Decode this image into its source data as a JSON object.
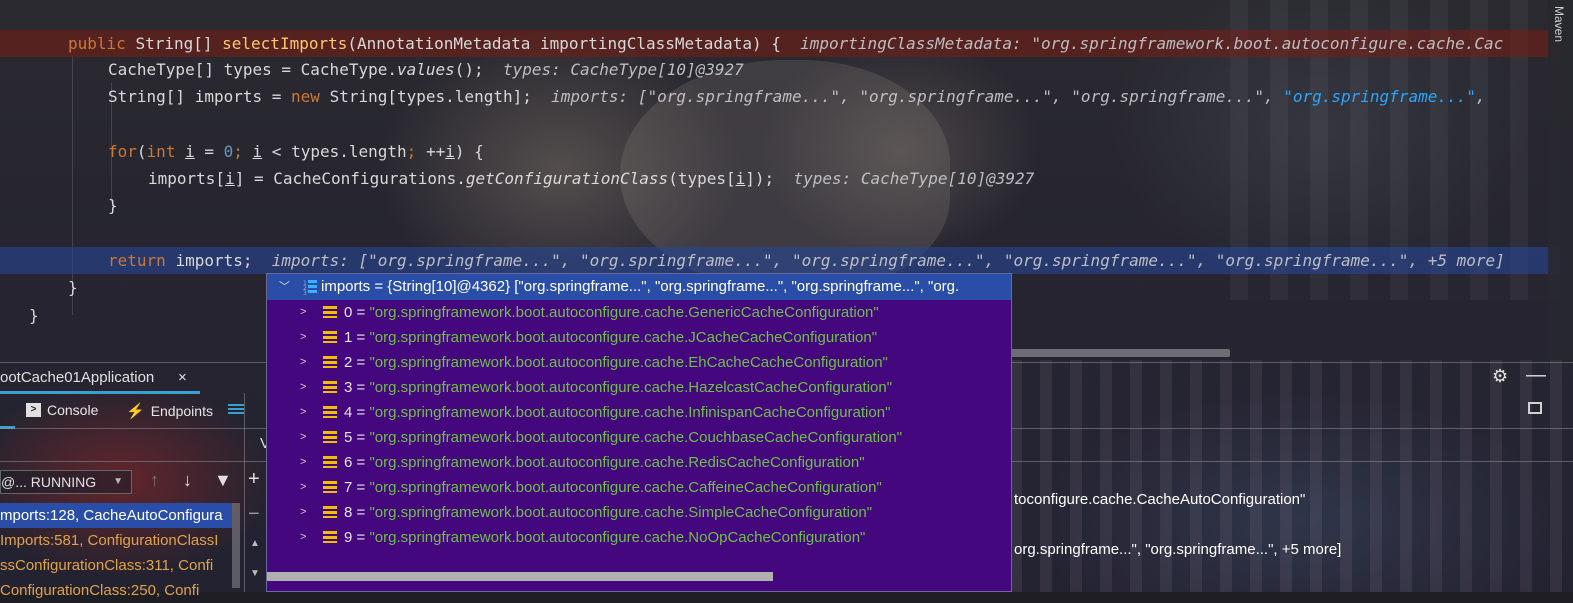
{
  "editor": {
    "lines": [
      {
        "segments": [
          {
            "t": "public ",
            "c": "kw"
          },
          {
            "t": "String[] ",
            "c": "txt"
          },
          {
            "t": "selectImports",
            "c": "fn"
          },
          {
            "t": "(AnnotationMetadata importingClassMetadata) {  ",
            "c": "txt"
          },
          {
            "t": "importingClassMetadata: \"org.springframework.boot.autoconfigure.cache.Cac",
            "c": "hint"
          }
        ]
      },
      {
        "segments": [
          {
            "t": "CacheType[] types = CacheType.",
            "c": "txt"
          },
          {
            "t": "values",
            "c": "it"
          },
          {
            "t": "();  ",
            "c": "txt"
          },
          {
            "t": "types: CacheType[10]@3927",
            "c": "hint"
          }
        ]
      },
      {
        "segments": [
          {
            "t": "String[] imports = ",
            "c": "txt"
          },
          {
            "t": "new ",
            "c": "kw"
          },
          {
            "t": "String[types.",
            "c": "txt"
          },
          {
            "t": "length",
            "c": "txt"
          },
          {
            "t": "];  ",
            "c": "txt"
          },
          {
            "t": "imports: [\"org.springframe...\", \"org.springframe...\", \"org.springframe...\", ",
            "c": "hint"
          },
          {
            "t": "\"org.springframe...\"",
            "c": "hint-blue"
          },
          {
            "t": ",",
            "c": "hint"
          }
        ]
      },
      {
        "segments": []
      },
      {
        "segments": [
          {
            "t": "for",
            "c": "kw"
          },
          {
            "t": "(",
            "c": "txt"
          },
          {
            "t": "int ",
            "c": "kw"
          },
          {
            "t": "i",
            "c": "ul"
          },
          {
            "t": " = ",
            "c": "txt"
          },
          {
            "t": "0",
            "c": "num"
          },
          {
            "t": "; ",
            "c": "kw"
          },
          {
            "t": "i",
            "c": "ul"
          },
          {
            "t": " < types.",
            "c": "txt"
          },
          {
            "t": "length",
            "c": "txt"
          },
          {
            "t": "; ",
            "c": "kw"
          },
          {
            "t": "++",
            "c": "txt"
          },
          {
            "t": "i",
            "c": "ul"
          },
          {
            "t": ") {",
            "c": "txt"
          }
        ]
      },
      {
        "segments": [
          {
            "t": "imports[",
            "c": "txt"
          },
          {
            "t": "i",
            "c": "ul"
          },
          {
            "t": "] = CacheConfigurations.",
            "c": "txt"
          },
          {
            "t": "getConfigurationClass",
            "c": "it"
          },
          {
            "t": "(types[",
            "c": "txt"
          },
          {
            "t": "i",
            "c": "ul"
          },
          {
            "t": "]);  ",
            "c": "txt"
          },
          {
            "t": "types: CacheType[10]@3927",
            "c": "hint"
          }
        ]
      },
      {
        "segments": [
          {
            "t": "}",
            "c": "txt"
          }
        ]
      },
      {
        "segments": []
      },
      {
        "segments": [
          {
            "t": "return ",
            "c": "kw"
          },
          {
            "t": "imports;  ",
            "c": "txt"
          },
          {
            "t": "imports: [\"org.springframe...\", \"org.springframe...\", \"org.springframe...\", \"org.springframe...\", \"org.springframe...\", +5 more]",
            "c": "hint"
          }
        ]
      },
      {
        "segments": [
          {
            "t": "}",
            "c": "txt"
          }
        ]
      },
      {
        "segments": [
          {
            "t": "}",
            "c": "txt"
          }
        ]
      }
    ]
  },
  "tool_strip": {
    "maven_label": "Maven"
  },
  "run": {
    "tab_label": "ootCache01Application",
    "tab_close": "×",
    "subtabs": {
      "console": "Console",
      "endpoints": "Endpoints"
    },
    "var_tab_partial": "V",
    "thread_selector": "@... RUNNING",
    "frames": [
      {
        "text": "mports:128, CacheAutoConfigura",
        "kind": "sel"
      },
      {
        "text": "Imports:581, ConfigurationClassI",
        "kind": "lib"
      },
      {
        "text": "ssConfigurationClass:311, Confi",
        "kind": "lib"
      },
      {
        "text": "ConfigurationClass:250, Confi",
        "kind": "lib"
      }
    ],
    "bg_var_1": "toconfigure.cache.CacheAutoConfiguration\"",
    "bg_var_2": "org.springframe...\", \"org.springframe...\", +5 more]"
  },
  "popup": {
    "header": "imports = {String[10]@4362} [\"org.springframe...\", \"org.springframe...\", \"org.springframe...\", \"org.",
    "items": [
      {
        "idx": "0 = ",
        "val": "\"org.springframework.boot.autoconfigure.cache.GenericCacheConfiguration\""
      },
      {
        "idx": "1 = ",
        "val": "\"org.springframework.boot.autoconfigure.cache.JCacheCacheConfiguration\""
      },
      {
        "idx": "2 = ",
        "val": "\"org.springframework.boot.autoconfigure.cache.EhCacheCacheConfiguration\""
      },
      {
        "idx": "3 = ",
        "val": "\"org.springframework.boot.autoconfigure.cache.HazelcastCacheConfiguration\""
      },
      {
        "idx": "4 = ",
        "val": "\"org.springframework.boot.autoconfigure.cache.InfinispanCacheConfiguration\""
      },
      {
        "idx": "5 = ",
        "val": "\"org.springframework.boot.autoconfigure.cache.CouchbaseCacheConfiguration\""
      },
      {
        "idx": "6 = ",
        "val": "\"org.springframework.boot.autoconfigure.cache.RedisCacheConfiguration\""
      },
      {
        "idx": "7 = ",
        "val": "\"org.springframework.boot.autoconfigure.cache.CaffeineCacheConfiguration\""
      },
      {
        "idx": "8 = ",
        "val": "\"org.springframework.boot.autoconfigure.cache.SimpleCacheConfiguration\""
      },
      {
        "idx": "9 = ",
        "val": "\"org.springframework.boot.autoconfigure.cache.NoOpCacheConfiguration\""
      }
    ]
  },
  "colors": {
    "keyword": "#cc7832",
    "method": "#ffc66d",
    "string_value": "#6fbf4a",
    "selection": "#2a4ea8",
    "popup_bg": "#44077e"
  }
}
